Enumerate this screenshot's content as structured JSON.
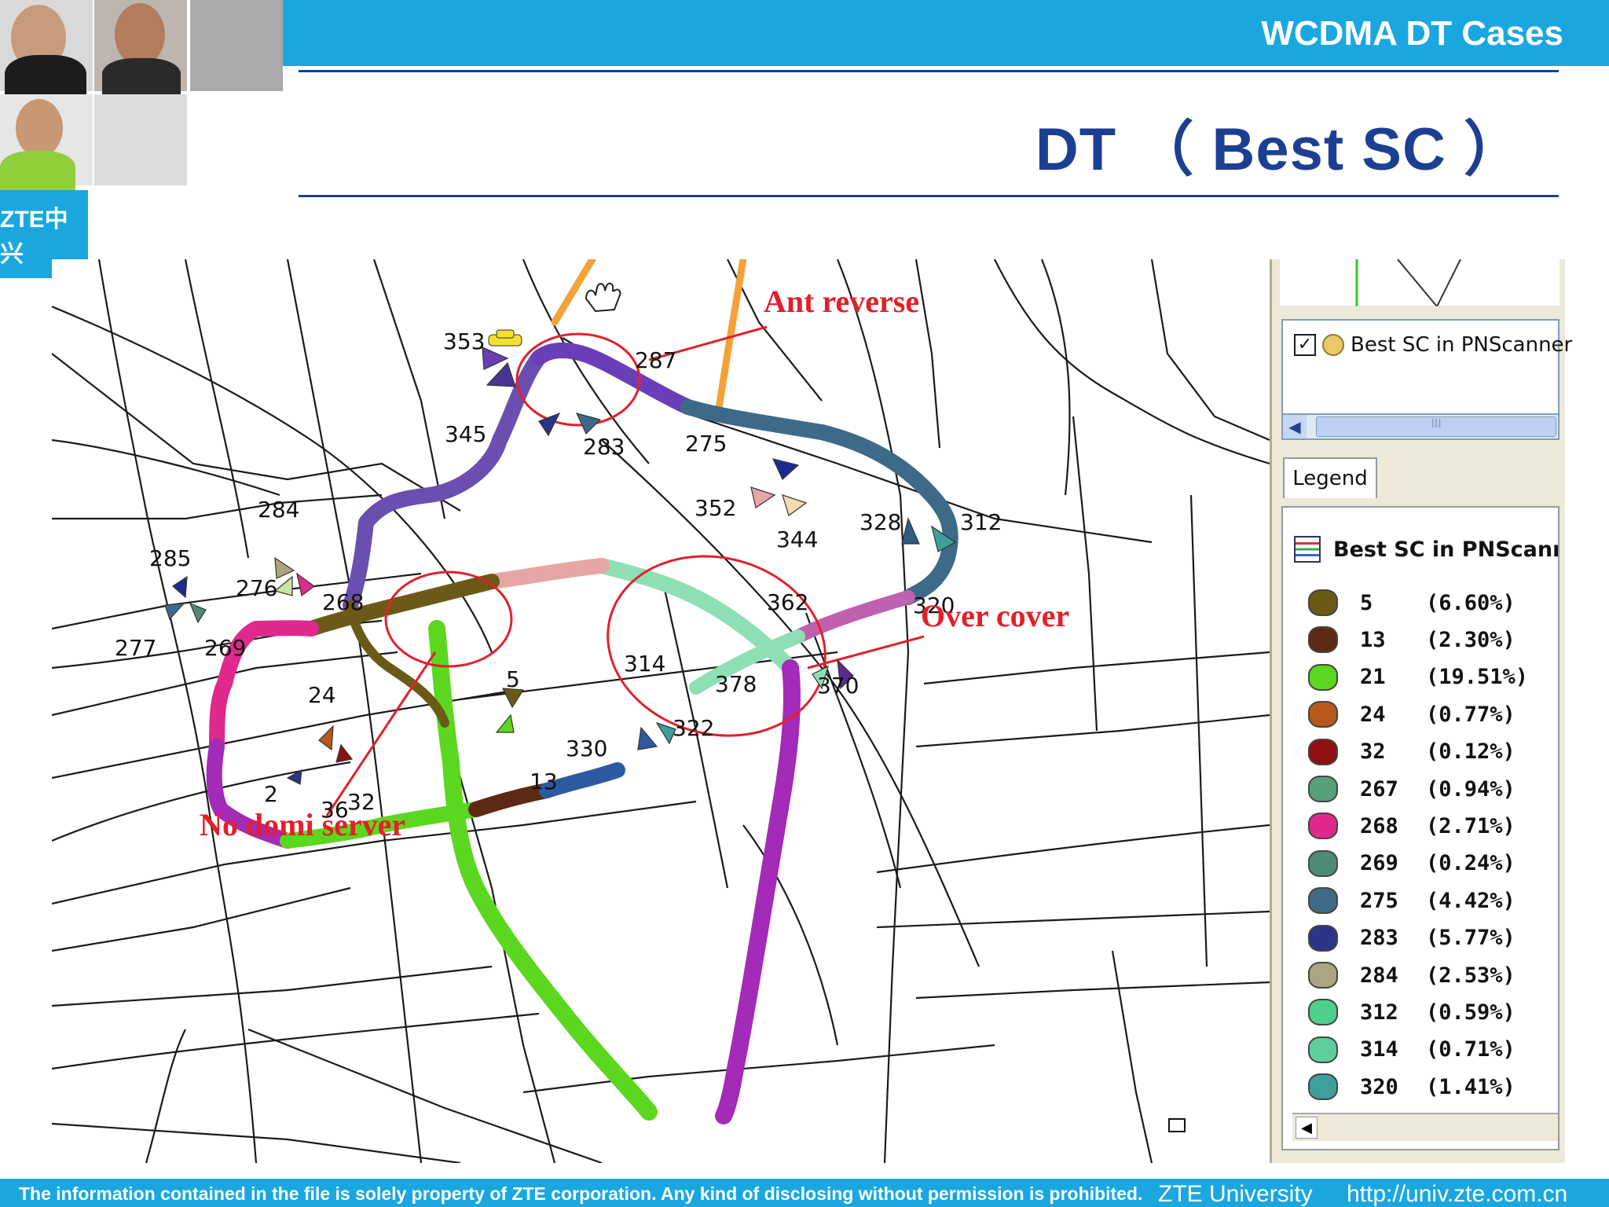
{
  "header": {
    "deck_title": "WCDMA DT  Cases",
    "slide_title": "DT  （  Best SC  ）"
  },
  "logo_text": "ZTE中兴",
  "map": {
    "site_labels": [
      {
        "id": "353",
        "text": "353"
      },
      {
        "id": "287",
        "text": "287"
      },
      {
        "id": "345",
        "text": "345"
      },
      {
        "id": "283",
        "text": "283"
      },
      {
        "id": "275",
        "text": "275"
      },
      {
        "id": "352",
        "text": "352"
      },
      {
        "id": "344",
        "text": "344"
      },
      {
        "id": "328",
        "text": "328"
      },
      {
        "id": "312",
        "text": "312"
      },
      {
        "id": "284",
        "text": "284"
      },
      {
        "id": "285",
        "text": "285"
      },
      {
        "id": "276",
        "text": "276"
      },
      {
        "id": "268",
        "text": "268"
      },
      {
        "id": "277",
        "text": "277"
      },
      {
        "id": "269",
        "text": "269"
      },
      {
        "id": "24",
        "text": "24"
      },
      {
        "id": "5",
        "text": "5"
      },
      {
        "id": "314",
        "text": "314"
      },
      {
        "id": "362",
        "text": "362"
      },
      {
        "id": "320",
        "text": "320"
      },
      {
        "id": "378",
        "text": "378"
      },
      {
        "id": "370",
        "text": "370"
      },
      {
        "id": "322",
        "text": "322"
      },
      {
        "id": "330",
        "text": "330"
      },
      {
        "id": "13",
        "text": "13"
      },
      {
        "id": "2",
        "text": "2"
      },
      {
        "id": "32",
        "text": "32"
      },
      {
        "id": "36",
        "text": "36"
      }
    ],
    "annotations": {
      "ant_reverse": "Ant reverse",
      "over_cover": "Over cover",
      "no_domi_server": "No domi server"
    }
  },
  "legend_panel": {
    "layer_name": "Best SC in PNScanner",
    "tab_label": "Legend",
    "legend_title": "Best SC in PNScanner",
    "scroll_grip": "III",
    "items": [
      {
        "label": "5",
        "pct": "(6.60%)",
        "color": "#6b5a16"
      },
      {
        "label": "13",
        "pct": "(2.30%)",
        "color": "#5c2a12"
      },
      {
        "label": "21",
        "pct": "(19.51%)",
        "color": "#5cd71f"
      },
      {
        "label": "24",
        "pct": "(0.77%)",
        "color": "#b8581a"
      },
      {
        "label": "32",
        "pct": "(0.12%)",
        "color": "#8e1010"
      },
      {
        "label": "267",
        "pct": "(0.94%)",
        "color": "#58a078"
      },
      {
        "label": "268",
        "pct": "(2.71%)",
        "color": "#e0298c"
      },
      {
        "label": "269",
        "pct": "(0.24%)",
        "color": "#4f8a78"
      },
      {
        "label": "275",
        "pct": "(4.42%)",
        "color": "#3f6a86"
      },
      {
        "label": "283",
        "pct": "(5.77%)",
        "color": "#2c3488"
      },
      {
        "label": "284",
        "pct": "(2.53%)",
        "color": "#a9a680"
      },
      {
        "label": "312",
        "pct": "(0.59%)",
        "color": "#4dcf8e"
      },
      {
        "label": "314",
        "pct": "(0.71%)",
        "color": "#5ccf9c"
      },
      {
        "label": "320",
        "pct": "(1.41%)",
        "color": "#3e9e9a"
      }
    ]
  },
  "footer": {
    "disclaimer": "The information contained in the file is solely property of ZTE corporation. Any kind of disclosing without permission is prohibited.",
    "university": "ZTE University",
    "url": "http://univ.zte.com.cn"
  }
}
